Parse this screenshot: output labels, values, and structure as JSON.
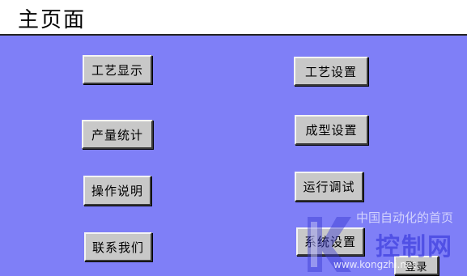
{
  "page_title": "主页面",
  "buttons": {
    "process_display": "工艺显示",
    "process_settings": "工艺设置",
    "production_stats": "产量统计",
    "molding_settings": "成型设置",
    "operation_manual": "操作说明",
    "run_debug": "运行调试",
    "contact_us": "联系我们",
    "system_settings": "系统设置",
    "login": "登录"
  },
  "watermark": {
    "line1": "中国自动化的首页",
    "line2": "控制网",
    "line3": "www.kongzhi.net"
  },
  "colors": {
    "panel_background": "#7f7ff7",
    "button_face": "#c8c8c8"
  }
}
